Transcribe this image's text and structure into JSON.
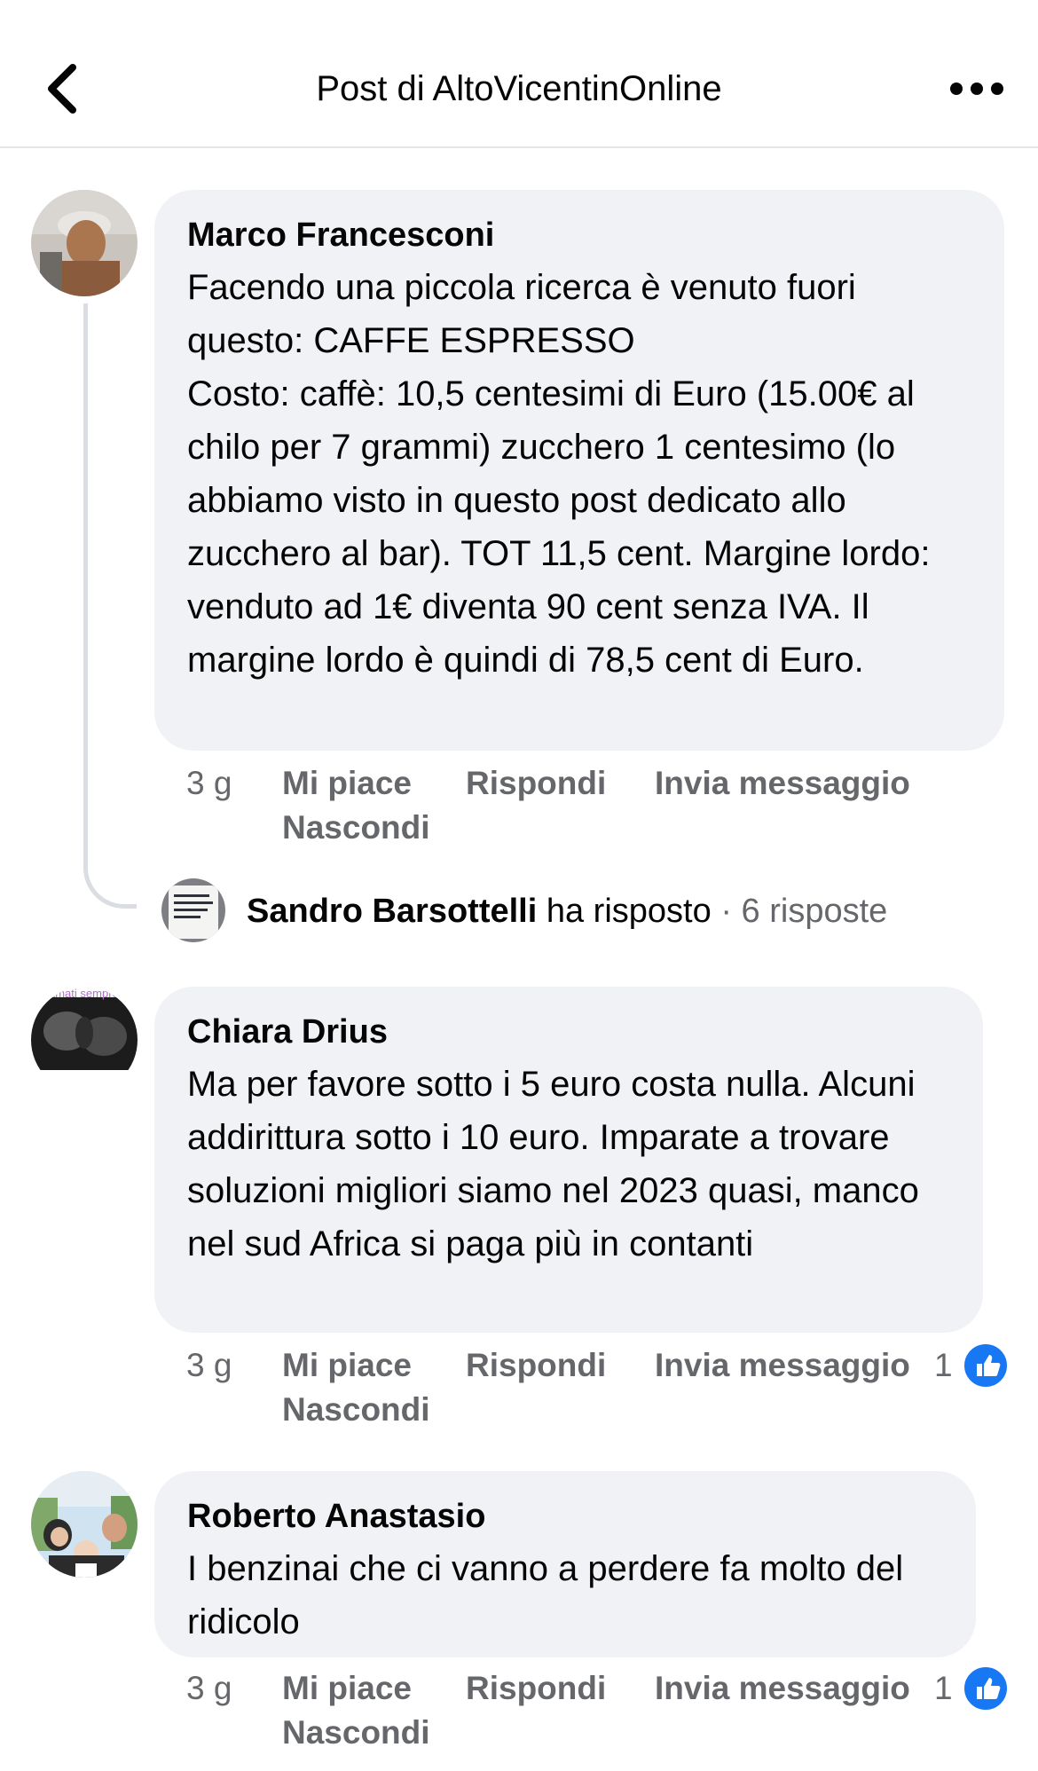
{
  "header": {
    "title": "Post di AltoVicentinOnline",
    "back_icon": "chevron-left-icon",
    "more_icon": "more-horizontal-icon"
  },
  "comments": [
    {
      "author": "Marco Francesconi",
      "text": "Facendo una piccola ricerca è venuto fuori questo: CAFFE ESPRESSO\nCosto: caffè: 10,5 centesimi di Euro (15.00€ al chilo per 7 grammi) zucchero 1 centesimo (lo abbiamo visto in questo post dedicato allo zucchero al bar). TOT 11,5 cent. Margine lordo: venduto ad 1€ diventa 90 cent senza IVA. Il margine lordo è quindi di 78,5 cent di Euro.",
      "time": "3 g",
      "like": "Mi piace",
      "reply": "Rispondi",
      "message": "Invia messaggio",
      "hide": "Nascondi",
      "replies_summary": {
        "name": "Sandro Barsottelli",
        "verb": "ha risposto",
        "separator": "·",
        "count": "6 risposte"
      }
    },
    {
      "author": "Chiara Drius",
      "avatar_caption": "amati sempre",
      "text": "Ma per favore sotto i 5 euro costa nulla. Alcuni addirittura sotto i 10 euro. Imparate a trovare soluzioni migliori siamo nel 2023 quasi, manco nel sud Africa si paga più in contanti",
      "time": "3 g",
      "like": "Mi piace",
      "reply": "Rispondi",
      "message": "Invia messaggio",
      "hide": "Nascondi",
      "reactions": "1"
    },
    {
      "author": "Roberto Anastasio",
      "text": "I benzinai che ci vanno a perdere fa molto del ridicolo",
      "time": "3 g",
      "like": "Mi piace",
      "reply": "Rispondi",
      "message": "Invia messaggio",
      "hide": "Nascondi",
      "reactions": "1"
    }
  ],
  "colors": {
    "bubble": "#f0f2f5",
    "secondary_text": "#65676b",
    "like_blue": "#1877f2"
  }
}
